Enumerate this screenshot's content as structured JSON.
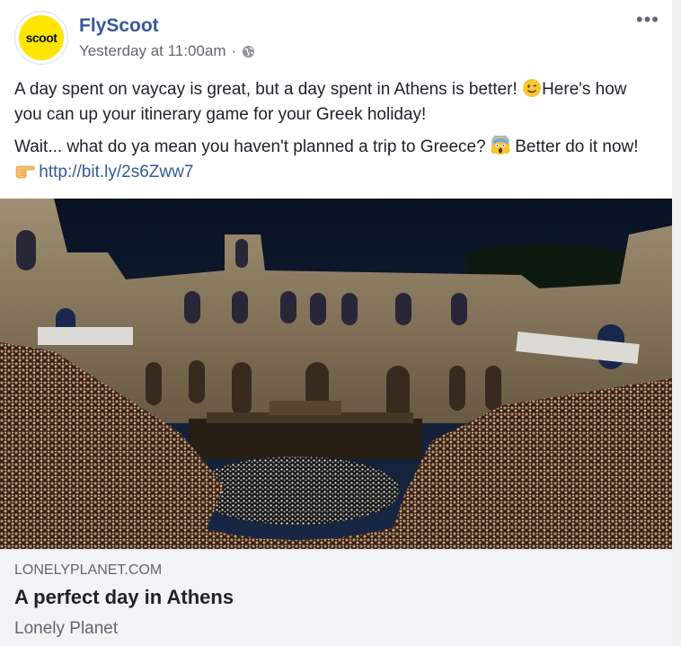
{
  "post": {
    "page_name": "FlyScoot",
    "avatar_text": "scoot",
    "timestamp": "Yesterday at 11:00am",
    "separator": "·",
    "privacy_icon": "globe-icon",
    "more_icon": "more-options-icon",
    "more_text": "•••",
    "paragraph1_a": "A day spent on vaycay is great, but a day spent in Athens is better! ",
    "paragraph1_emoji": "smiley-icon",
    "paragraph1_b": "Here's how you can up your itinerary game for your Greek holiday!",
    "paragraph2_a": "Wait... what do ya mean you haven't planned a trip to Greece? ",
    "paragraph2_emoji1": "screaming-face-icon",
    "paragraph2_b": " Better do it now! ",
    "paragraph2_emoji2": "pointing-right-icon",
    "link_text": "http://bit.ly/2s6Zww7"
  },
  "preview": {
    "domain": "LONELYPLANET.COM",
    "title": "A perfect day in Athens",
    "source": "Lonely Planet"
  },
  "colors": {
    "brand_yellow": "#ffe500",
    "link_blue": "#365899",
    "text": "#1d2129",
    "muted": "#616770"
  }
}
